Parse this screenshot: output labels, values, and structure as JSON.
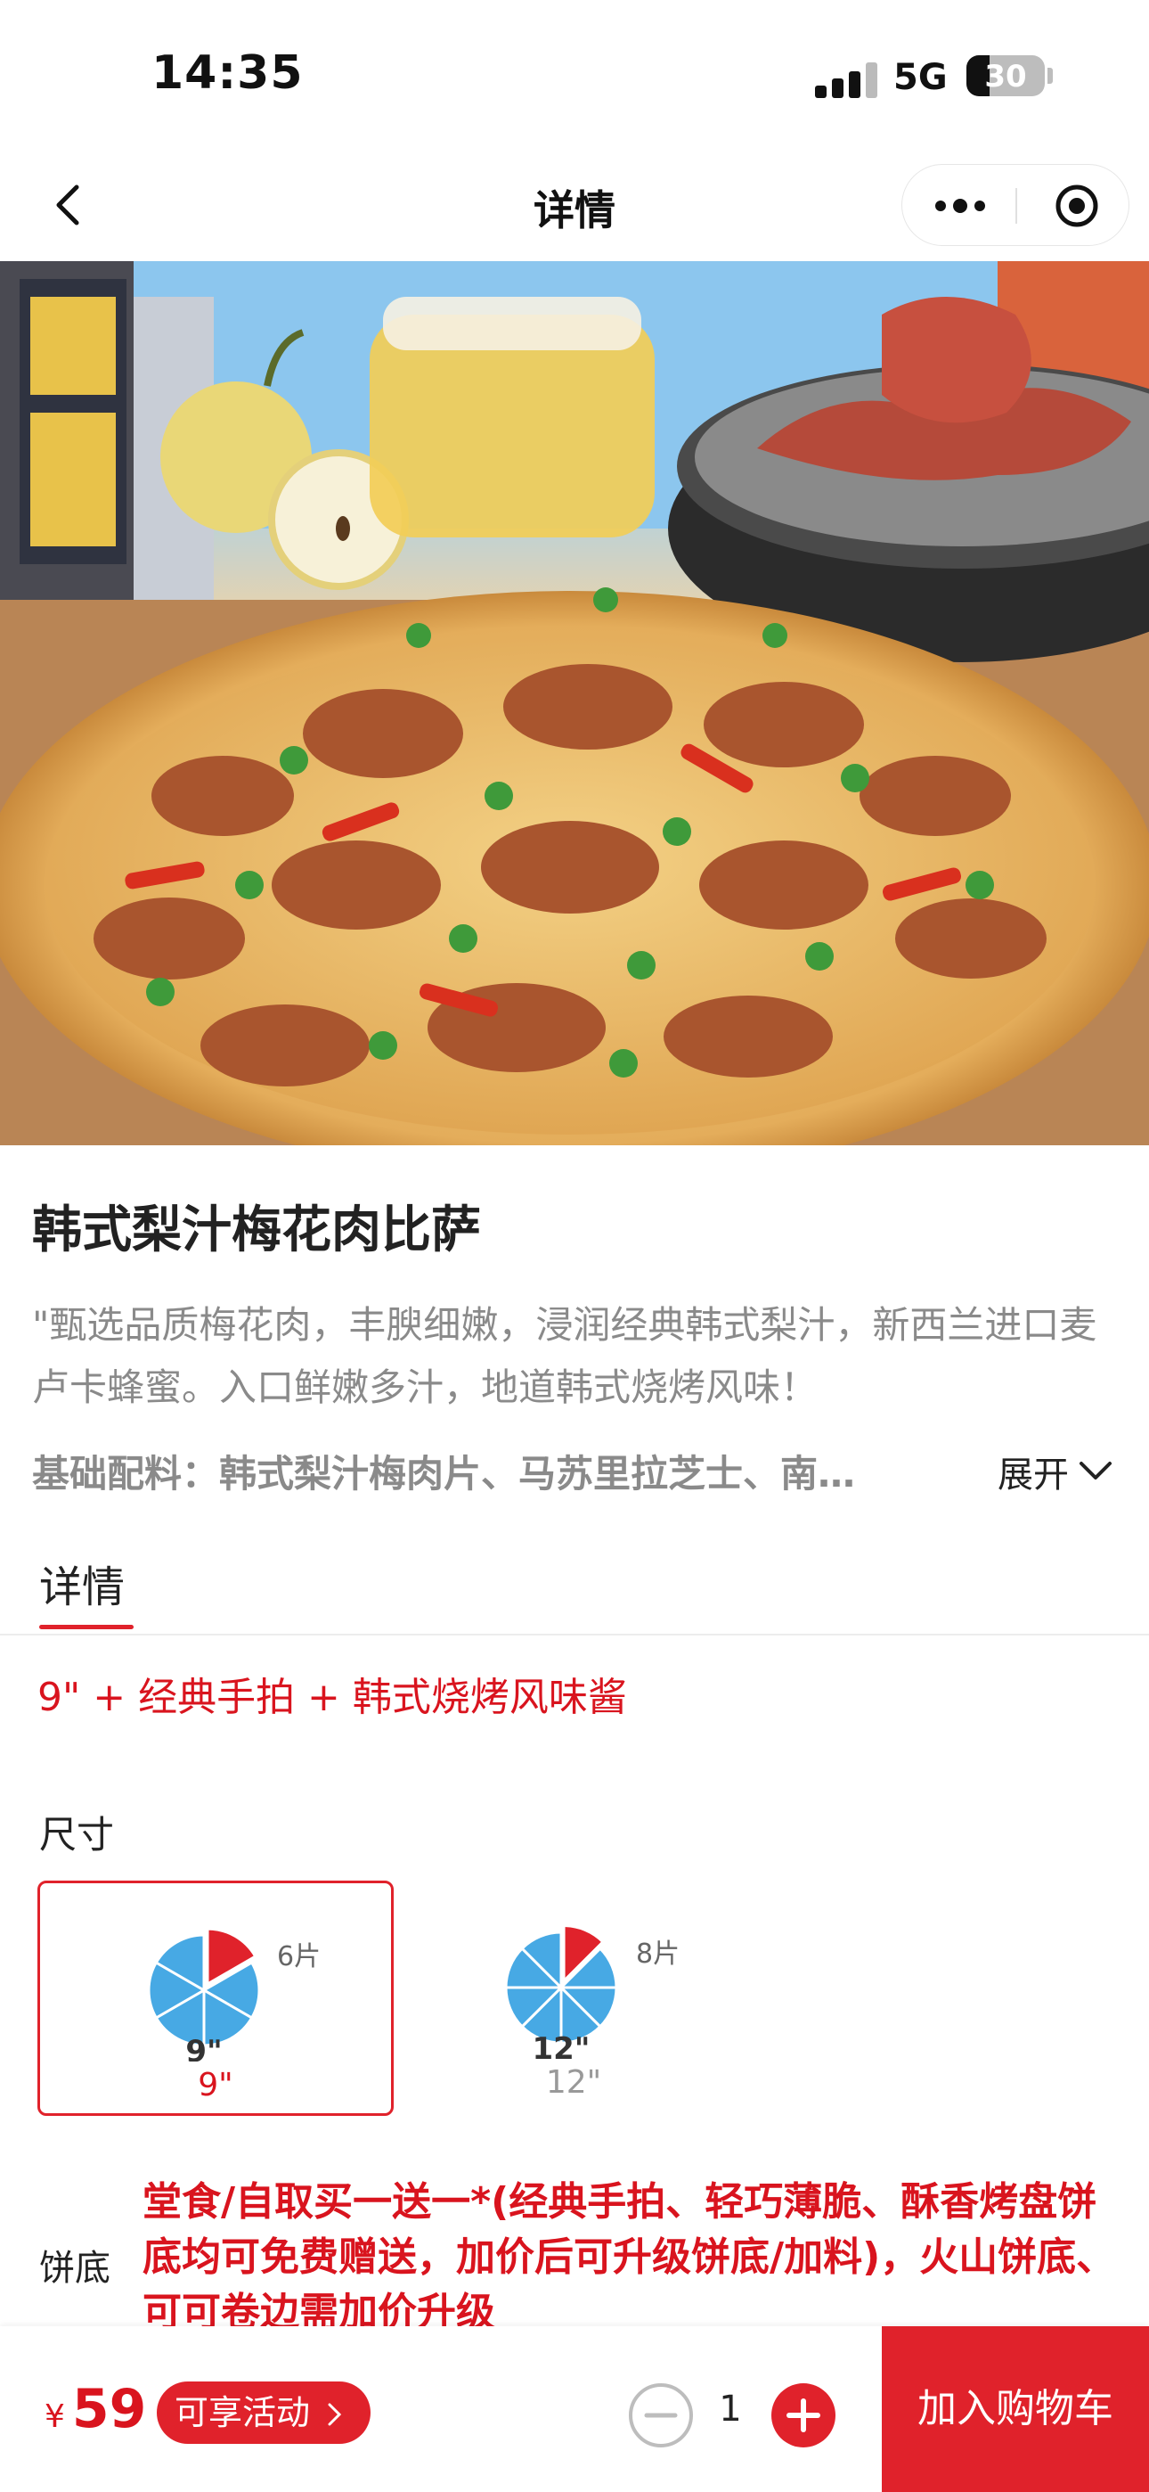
{
  "status_bar": {
    "time": "14:35",
    "network": "5G",
    "battery": "30",
    "battery_level": 0.3
  },
  "nav": {
    "title": "详情"
  },
  "product": {
    "name": "韩式梨汁梅花肉比萨",
    "description": "\"甄选品质梅花肉，丰腴细嫩，浸润经典韩式梨汁，新西兰进口麦卢卡蜂蜜。入口鲜嫩多汁，地道韩式烧烤风味！",
    "ingredients": "基础配料：韩式梨汁梅肉片、马苏里拉芝士、南…",
    "expand_label": "展开"
  },
  "tabs": [
    {
      "label": "详情",
      "active": true
    }
  ],
  "selection_summary": "9\" + 经典手拍 + 韩式烧烤风味酱",
  "size": {
    "label": "尺寸",
    "options": [
      {
        "slices": "6片",
        "size_icon_label": "9\"",
        "value": "9\"",
        "selected": true,
        "slice_count": 6
      },
      {
        "slices": "8片",
        "size_icon_label": "12\"",
        "value": "12\"",
        "selected": false,
        "slice_count": 8
      }
    ]
  },
  "crust": {
    "label": "饼底",
    "note": "堂食/自取买一送一*(经典手拍、轻巧薄脆、酥香烤盘饼底均可免费赠送，加价后可升级饼底/加料)，火山饼底、可可卷边需加价升级"
  },
  "bottom_bar": {
    "currency": "¥",
    "price": "59",
    "promo": "可享活动",
    "quantity": "1",
    "add_to_cart": "加入购物车"
  },
  "colors": {
    "accent": "#e0222b",
    "accent_text": "#d9141e",
    "pie_blue": "#47a9e4"
  }
}
